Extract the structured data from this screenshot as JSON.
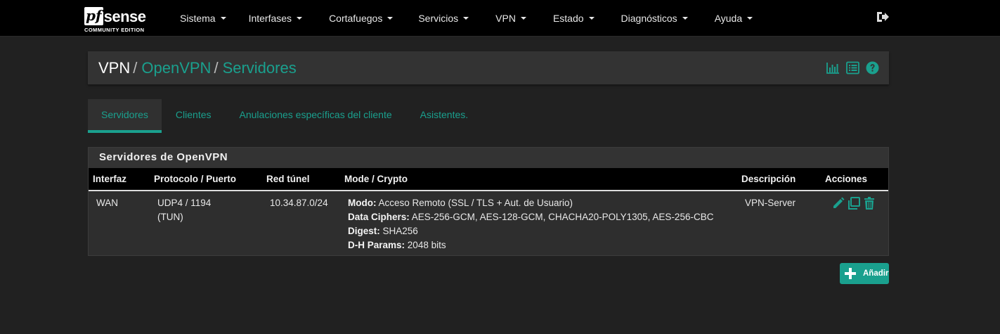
{
  "brand": {
    "logo_pf": "pf",
    "logo_sense": "sense",
    "edition": "COMMUNITY EDITION"
  },
  "nav": {
    "items": [
      {
        "label": "Sistema"
      },
      {
        "label": "Interfases"
      },
      {
        "label": "Cortafuegos"
      },
      {
        "label": "Servicios"
      },
      {
        "label": "VPN"
      },
      {
        "label": "Estado"
      },
      {
        "label": "Diagnósticos"
      },
      {
        "label": "Ayuda"
      }
    ],
    "logout_icon": "sign-out-icon"
  },
  "breadcrumb": {
    "root": "VPN",
    "level1": "OpenVPN",
    "level2": "Servidores",
    "separator": "/"
  },
  "header_icons": [
    "bar-chart-icon",
    "list-log-icon",
    "help-icon"
  ],
  "tabs": [
    {
      "label": "Servidores",
      "active": true
    },
    {
      "label": "Clientes",
      "active": false
    },
    {
      "label": "Anulaciones específicas del cliente",
      "active": false
    },
    {
      "label": "Asistentes.",
      "active": false
    }
  ],
  "panel": {
    "title": "Servidores de OpenVPN",
    "columns": [
      "Interfaz",
      "Protocolo / Puerto",
      "Red túnel",
      "Mode / Crypto",
      "Descripción",
      "Acciones"
    ],
    "rows": [
      {
        "interface": "WAN",
        "protocol": "UDP4 / 1194",
        "protocol_mode": "(TUN)",
        "tunnel": "10.34.87.0/24",
        "mode_label": "Modo:",
        "mode_value": "Acceso Remoto (SSL / TLS + Aut. de Usuario)",
        "ciphers_label": "Data Ciphers:",
        "ciphers_value": "AES-256-GCM, AES-128-GCM, CHACHA20-POLY1305, AES-256-CBC",
        "digest_label": "Digest:",
        "digest_value": "SHA256",
        "dh_label": "D-H Params:",
        "dh_value": "2048 bits",
        "description": "VPN-Server",
        "actions": [
          "edit-pencil-icon",
          "copy-clone-icon",
          "trash-icon"
        ]
      }
    ]
  },
  "add_button": {
    "label": "Añadir",
    "icon": "plus-icon"
  },
  "colors": {
    "accent": "#1aa08e",
    "navbar": "#000000",
    "background": "#212121",
    "panel": "#333333"
  }
}
